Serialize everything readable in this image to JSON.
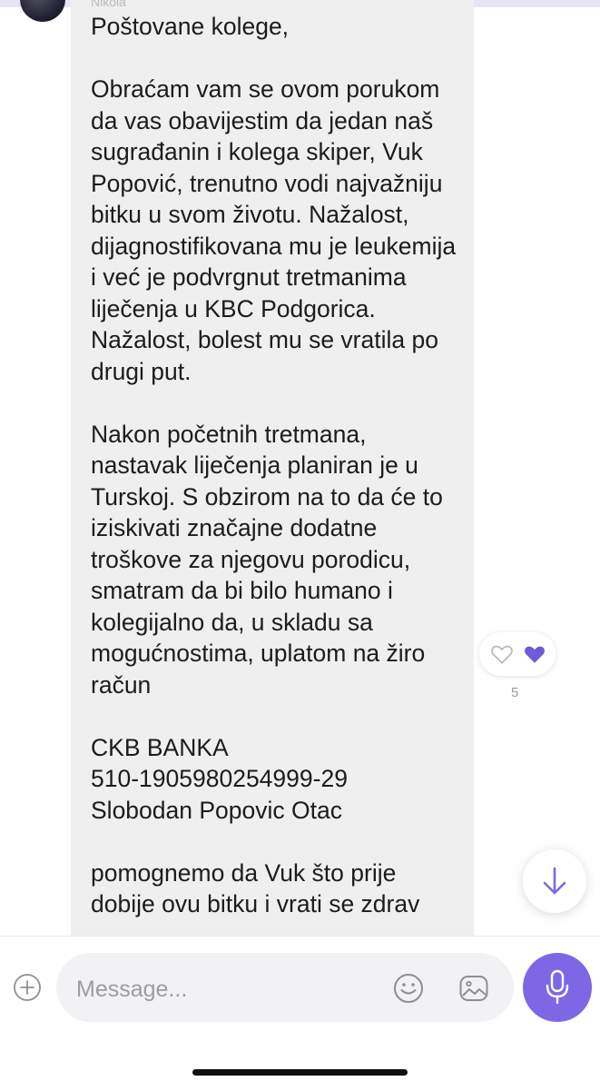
{
  "chat": {
    "sender_name": "Nikola",
    "message_paragraphs": [
      "Poštovane kolege,",
      "Obraćam vam se ovom porukom da vas obavijestim da jedan naš sugrađanin i kolega skiper, Vuk Popović, trenutno vodi najvažniju bitku u svom životu. Nažalost, dijagnostifikovana mu je leukemija i već je podvrgnut tretmanima liječenja u KBC Podgorica. Nažalost, bolest mu se vratila po drugi put.",
      "Nakon početnih tretmana, nastavak liječenja planiran je u Turskoj. S obzirom na to da će to iziskivati značajne dodatne troškove za njegovu porodicu, smatram da bi bilo humano i kolegijalno da, u skladu sa mogućnostima, uplatom na žiro račun",
      "CKB BANKA",
      "510-1905980254999-29",
      "Slobodan Popovic Otac",
      "pomognemo da Vuk što prije dobije ovu bitku i vrati se zdrav"
    ],
    "reaction_count": "5",
    "colors": {
      "accent": "#7d67e5",
      "bubble": "#efefef",
      "liked_heart": "#6f5ad9"
    }
  },
  "composer": {
    "placeholder": "Message...",
    "value": ""
  },
  "icons": {
    "add": "plus-circle-icon",
    "emoji": "smiley-icon",
    "sticker": "image-sticker-icon",
    "mic": "microphone-icon",
    "scroll": "arrow-down-icon"
  }
}
